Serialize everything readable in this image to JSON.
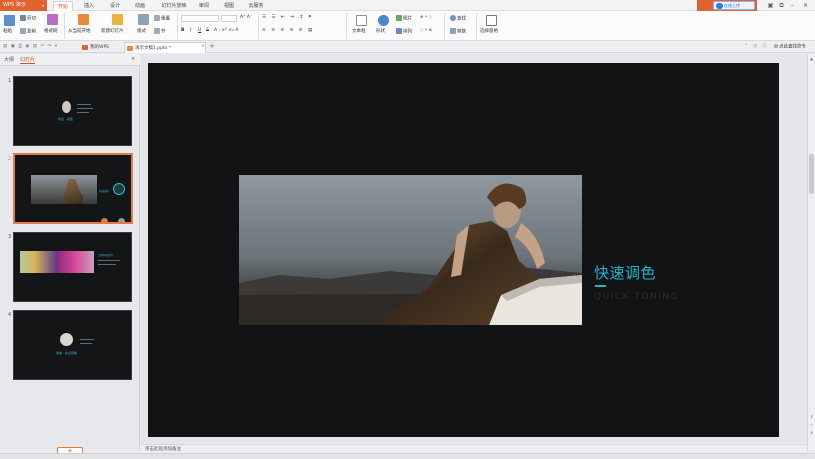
{
  "app": {
    "name": "WPS 演示"
  },
  "menu_tabs": [
    "开始",
    "插入",
    "设计",
    "动画",
    "幻灯片放映",
    "审阅",
    "视图",
    "云服务"
  ],
  "cloud_button": "在线上传",
  "ribbon": {
    "paste": "粘贴",
    "cut": "剪切",
    "copy": "复制",
    "format_painter": "格式刷",
    "from_current": "从当前开始",
    "new_slide": "新建幻灯片",
    "layout": "版式",
    "reset": "重置",
    "section": "节",
    "textbox": "文本框",
    "shape": "形状",
    "picture": "图片",
    "arrange": "排列",
    "find": "查找",
    "replace": "替换",
    "select_pane": "选择窗格",
    "bold": "B",
    "italic": "I",
    "underline": "U",
    "strike": "S"
  },
  "doc_tabs": [
    {
      "label": "我的WPS"
    },
    {
      "label": "演示文稿1.pptx *"
    }
  ],
  "search_label": "点此查找命令",
  "panel": {
    "tabs": [
      "大纲",
      "幻灯片"
    ],
    "slides": [
      {
        "num": "1",
        "title": "欢迎 · 模板"
      },
      {
        "num": "2",
        "title": "快速调色"
      },
      {
        "num": "3",
        "title": "主题风格制作"
      },
      {
        "num": "4",
        "title": "谢谢 · 欢迎观看"
      }
    ]
  },
  "slide": {
    "title": "快速调色",
    "subtitle": "QUICK TONING"
  },
  "notes_placeholder": "单击此处添加备注",
  "colors": {
    "accent_orange": "#e2622e",
    "slide_bg": "#121315",
    "title_cyan": "#1fb6cc"
  }
}
